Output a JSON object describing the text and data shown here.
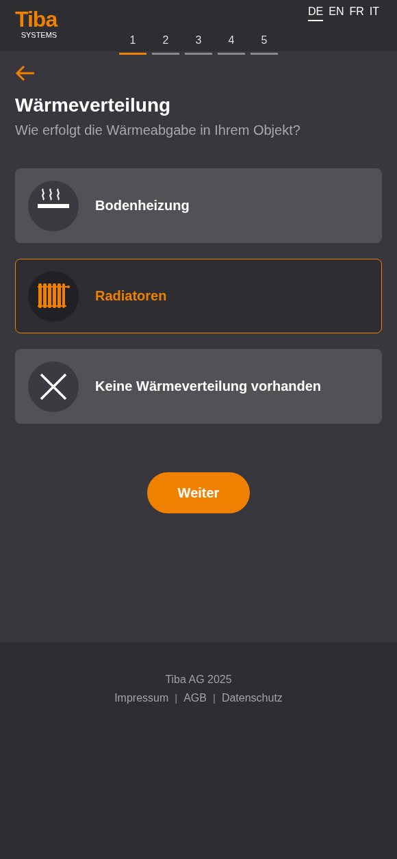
{
  "header": {
    "logo": {
      "name": "Tiba",
      "subtitle": "SYSTEMS"
    },
    "languages": [
      {
        "label": "DE",
        "selected": true
      },
      {
        "label": "EN",
        "selected": false
      },
      {
        "label": "FR",
        "selected": false
      },
      {
        "label": "IT",
        "selected": false
      }
    ],
    "steps": [
      {
        "label": "1",
        "selected": true
      },
      {
        "label": "2",
        "selected": false
      },
      {
        "label": "3",
        "selected": false
      },
      {
        "label": "4",
        "selected": false
      },
      {
        "label": "5",
        "selected": false
      }
    ]
  },
  "title": "Wärmeverteilung",
  "subtitle": "Wie erfolgt die Wärmeabgabe in Ihrem Objekt?",
  "options": [
    {
      "kind": "floor_heating",
      "label": "Bodenheizung",
      "selected": false
    },
    {
      "kind": "radiator",
      "label": "Radiatoren",
      "selected": true
    },
    {
      "kind": "none",
      "label": "Keine Wärmeverteilung vorhanden",
      "selected": false
    }
  ],
  "next_button": "Weiter",
  "footer": {
    "copyright": "Tiba AG 2025",
    "items": [
      {
        "kind": "link",
        "text": "Impressum"
      },
      {
        "kind": "separator",
        "text": "|"
      },
      {
        "kind": "link",
        "text": "AGB"
      },
      {
        "kind": "separator",
        "text": "|"
      },
      {
        "kind": "link",
        "text": "Datenschutz"
      }
    ]
  }
}
